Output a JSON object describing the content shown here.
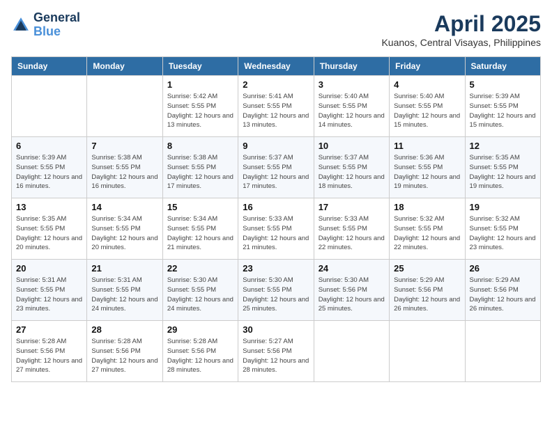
{
  "header": {
    "logo_line1": "General",
    "logo_line2": "Blue",
    "month": "April 2025",
    "location": "Kuanos, Central Visayas, Philippines"
  },
  "weekdays": [
    "Sunday",
    "Monday",
    "Tuesday",
    "Wednesday",
    "Thursday",
    "Friday",
    "Saturday"
  ],
  "weeks": [
    [
      {
        "day": "",
        "sunrise": "",
        "sunset": "",
        "daylight": ""
      },
      {
        "day": "",
        "sunrise": "",
        "sunset": "",
        "daylight": ""
      },
      {
        "day": "1",
        "sunrise": "Sunrise: 5:42 AM",
        "sunset": "Sunset: 5:55 PM",
        "daylight": "Daylight: 12 hours and 13 minutes."
      },
      {
        "day": "2",
        "sunrise": "Sunrise: 5:41 AM",
        "sunset": "Sunset: 5:55 PM",
        "daylight": "Daylight: 12 hours and 13 minutes."
      },
      {
        "day": "3",
        "sunrise": "Sunrise: 5:40 AM",
        "sunset": "Sunset: 5:55 PM",
        "daylight": "Daylight: 12 hours and 14 minutes."
      },
      {
        "day": "4",
        "sunrise": "Sunrise: 5:40 AM",
        "sunset": "Sunset: 5:55 PM",
        "daylight": "Daylight: 12 hours and 15 minutes."
      },
      {
        "day": "5",
        "sunrise": "Sunrise: 5:39 AM",
        "sunset": "Sunset: 5:55 PM",
        "daylight": "Daylight: 12 hours and 15 minutes."
      }
    ],
    [
      {
        "day": "6",
        "sunrise": "Sunrise: 5:39 AM",
        "sunset": "Sunset: 5:55 PM",
        "daylight": "Daylight: 12 hours and 16 minutes."
      },
      {
        "day": "7",
        "sunrise": "Sunrise: 5:38 AM",
        "sunset": "Sunset: 5:55 PM",
        "daylight": "Daylight: 12 hours and 16 minutes."
      },
      {
        "day": "8",
        "sunrise": "Sunrise: 5:38 AM",
        "sunset": "Sunset: 5:55 PM",
        "daylight": "Daylight: 12 hours and 17 minutes."
      },
      {
        "day": "9",
        "sunrise": "Sunrise: 5:37 AM",
        "sunset": "Sunset: 5:55 PM",
        "daylight": "Daylight: 12 hours and 17 minutes."
      },
      {
        "day": "10",
        "sunrise": "Sunrise: 5:37 AM",
        "sunset": "Sunset: 5:55 PM",
        "daylight": "Daylight: 12 hours and 18 minutes."
      },
      {
        "day": "11",
        "sunrise": "Sunrise: 5:36 AM",
        "sunset": "Sunset: 5:55 PM",
        "daylight": "Daylight: 12 hours and 19 minutes."
      },
      {
        "day": "12",
        "sunrise": "Sunrise: 5:35 AM",
        "sunset": "Sunset: 5:55 PM",
        "daylight": "Daylight: 12 hours and 19 minutes."
      }
    ],
    [
      {
        "day": "13",
        "sunrise": "Sunrise: 5:35 AM",
        "sunset": "Sunset: 5:55 PM",
        "daylight": "Daylight: 12 hours and 20 minutes."
      },
      {
        "day": "14",
        "sunrise": "Sunrise: 5:34 AM",
        "sunset": "Sunset: 5:55 PM",
        "daylight": "Daylight: 12 hours and 20 minutes."
      },
      {
        "day": "15",
        "sunrise": "Sunrise: 5:34 AM",
        "sunset": "Sunset: 5:55 PM",
        "daylight": "Daylight: 12 hours and 21 minutes."
      },
      {
        "day": "16",
        "sunrise": "Sunrise: 5:33 AM",
        "sunset": "Sunset: 5:55 PM",
        "daylight": "Daylight: 12 hours and 21 minutes."
      },
      {
        "day": "17",
        "sunrise": "Sunrise: 5:33 AM",
        "sunset": "Sunset: 5:55 PM",
        "daylight": "Daylight: 12 hours and 22 minutes."
      },
      {
        "day": "18",
        "sunrise": "Sunrise: 5:32 AM",
        "sunset": "Sunset: 5:55 PM",
        "daylight": "Daylight: 12 hours and 22 minutes."
      },
      {
        "day": "19",
        "sunrise": "Sunrise: 5:32 AM",
        "sunset": "Sunset: 5:55 PM",
        "daylight": "Daylight: 12 hours and 23 minutes."
      }
    ],
    [
      {
        "day": "20",
        "sunrise": "Sunrise: 5:31 AM",
        "sunset": "Sunset: 5:55 PM",
        "daylight": "Daylight: 12 hours and 23 minutes."
      },
      {
        "day": "21",
        "sunrise": "Sunrise: 5:31 AM",
        "sunset": "Sunset: 5:55 PM",
        "daylight": "Daylight: 12 hours and 24 minutes."
      },
      {
        "day": "22",
        "sunrise": "Sunrise: 5:30 AM",
        "sunset": "Sunset: 5:55 PM",
        "daylight": "Daylight: 12 hours and 24 minutes."
      },
      {
        "day": "23",
        "sunrise": "Sunrise: 5:30 AM",
        "sunset": "Sunset: 5:55 PM",
        "daylight": "Daylight: 12 hours and 25 minutes."
      },
      {
        "day": "24",
        "sunrise": "Sunrise: 5:30 AM",
        "sunset": "Sunset: 5:56 PM",
        "daylight": "Daylight: 12 hours and 25 minutes."
      },
      {
        "day": "25",
        "sunrise": "Sunrise: 5:29 AM",
        "sunset": "Sunset: 5:56 PM",
        "daylight": "Daylight: 12 hours and 26 minutes."
      },
      {
        "day": "26",
        "sunrise": "Sunrise: 5:29 AM",
        "sunset": "Sunset: 5:56 PM",
        "daylight": "Daylight: 12 hours and 26 minutes."
      }
    ],
    [
      {
        "day": "27",
        "sunrise": "Sunrise: 5:28 AM",
        "sunset": "Sunset: 5:56 PM",
        "daylight": "Daylight: 12 hours and 27 minutes."
      },
      {
        "day": "28",
        "sunrise": "Sunrise: 5:28 AM",
        "sunset": "Sunset: 5:56 PM",
        "daylight": "Daylight: 12 hours and 27 minutes."
      },
      {
        "day": "29",
        "sunrise": "Sunrise: 5:28 AM",
        "sunset": "Sunset: 5:56 PM",
        "daylight": "Daylight: 12 hours and 28 minutes."
      },
      {
        "day": "30",
        "sunrise": "Sunrise: 5:27 AM",
        "sunset": "Sunset: 5:56 PM",
        "daylight": "Daylight: 12 hours and 28 minutes."
      },
      {
        "day": "",
        "sunrise": "",
        "sunset": "",
        "daylight": ""
      },
      {
        "day": "",
        "sunrise": "",
        "sunset": "",
        "daylight": ""
      },
      {
        "day": "",
        "sunrise": "",
        "sunset": "",
        "daylight": ""
      }
    ]
  ]
}
